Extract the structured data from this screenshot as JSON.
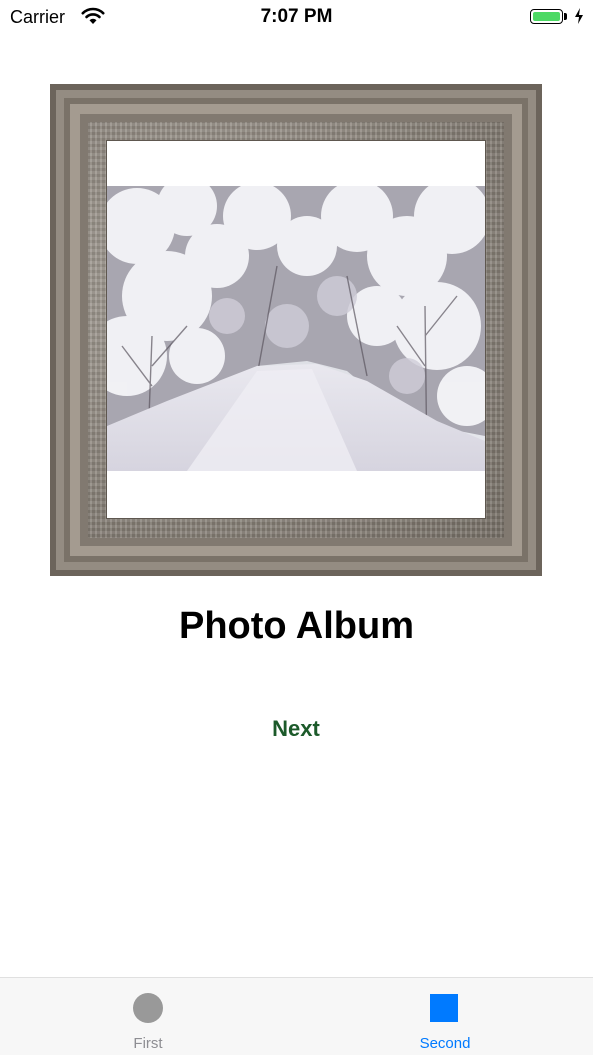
{
  "status_bar": {
    "carrier": "Carrier",
    "time": "7:07 PM",
    "wifi_icon": "wifi-icon",
    "battery_icon": "battery-icon",
    "charging_icon": "bolt-icon",
    "battery_color": "#4cd964"
  },
  "main": {
    "title": "Photo Album",
    "next_label": "Next",
    "next_color": "#1c5a2a"
  },
  "tab_bar": {
    "tabs": [
      {
        "label": "First",
        "icon": "circle-icon",
        "selected": false
      },
      {
        "label": "Second",
        "icon": "square-icon",
        "selected": true
      }
    ],
    "selected_color": "#007aff",
    "unselected_color": "#8e8e93"
  }
}
